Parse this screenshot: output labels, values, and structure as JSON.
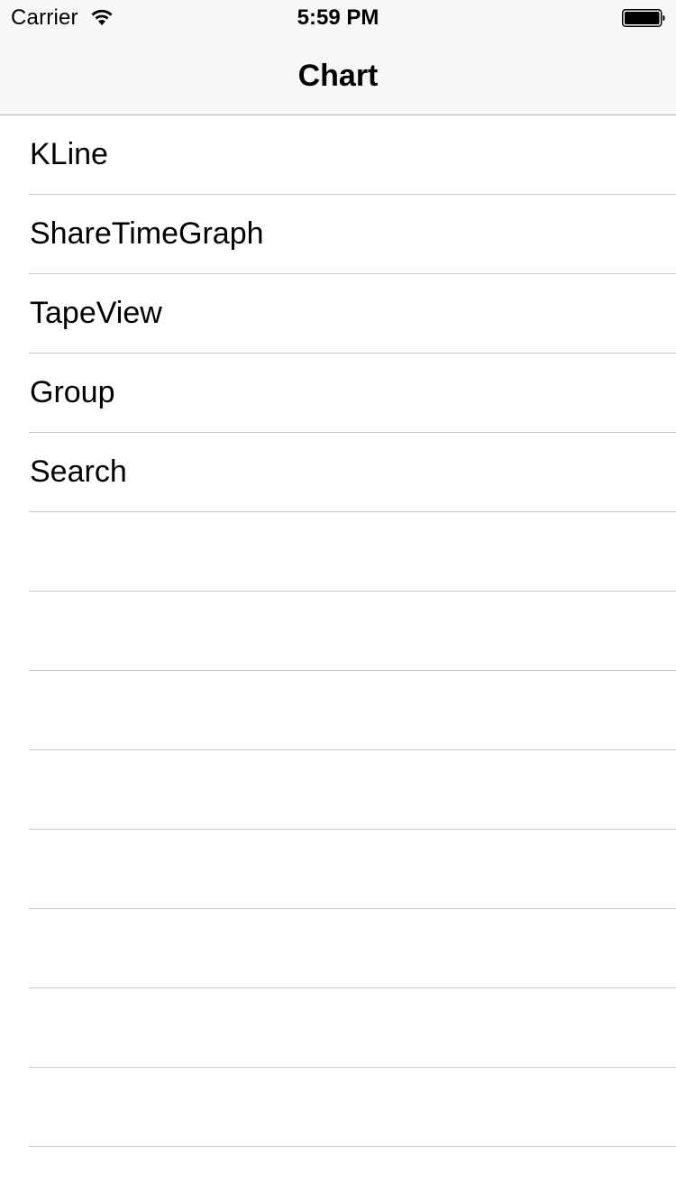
{
  "status_bar": {
    "carrier": "Carrier",
    "time": "5:59 PM",
    "wifi_icon": "wifi-icon",
    "battery_icon": "battery-icon"
  },
  "nav": {
    "title": "Chart"
  },
  "table": {
    "items": [
      {
        "label": "KLine"
      },
      {
        "label": "ShareTimeGraph"
      },
      {
        "label": "TapeView"
      },
      {
        "label": "Group"
      },
      {
        "label": "Search"
      },
      {
        "label": ""
      },
      {
        "label": ""
      },
      {
        "label": ""
      },
      {
        "label": ""
      },
      {
        "label": ""
      },
      {
        "label": ""
      },
      {
        "label": ""
      },
      {
        "label": ""
      }
    ]
  },
  "colors": {
    "nav_background": "#f7f7f7",
    "separator": "#c8c7cc",
    "text": "#000000"
  }
}
